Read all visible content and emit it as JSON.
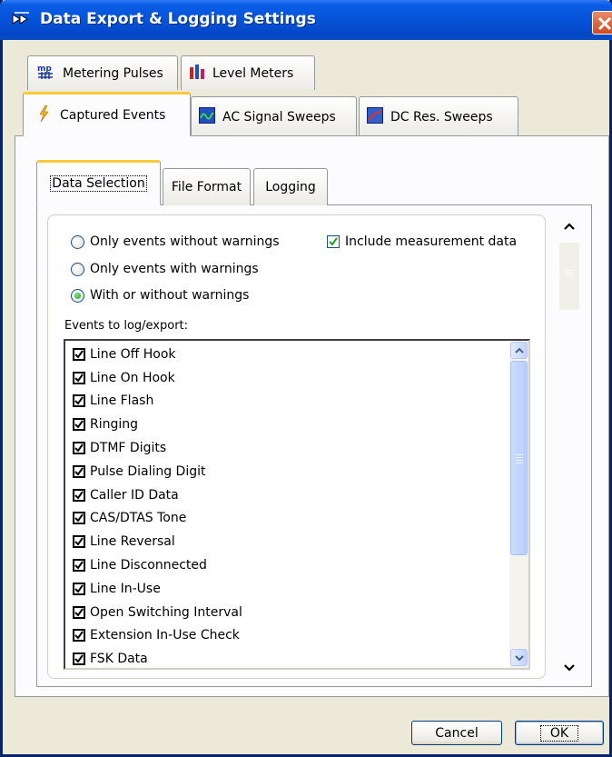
{
  "window": {
    "title": "Data Export & Logging Settings",
    "close_icon": "close-icon"
  },
  "outer_tabs": {
    "row1": [
      {
        "label": "Metering Pulses",
        "icon": "metering-pulses-icon"
      },
      {
        "label": "Level Meters",
        "icon": "level-meters-icon"
      }
    ],
    "row2": [
      {
        "label": "Captured Events",
        "icon": "lightning-icon",
        "active": true
      },
      {
        "label": "AC Signal Sweeps",
        "icon": "ac-sweep-icon"
      },
      {
        "label": "DC Res. Sweeps",
        "icon": "dc-sweep-icon"
      }
    ]
  },
  "inner_tabs": [
    {
      "label": "Data Selection",
      "active": true
    },
    {
      "label": "File Format"
    },
    {
      "label": "Logging"
    }
  ],
  "warnings_filter": {
    "options": [
      {
        "label": "Only events without warnings",
        "checked": false
      },
      {
        "label": "Only events with warnings",
        "checked": false
      },
      {
        "label": "With or without warnings",
        "checked": true
      }
    ]
  },
  "include_measurement": {
    "label": "Include measurement data",
    "checked": true
  },
  "events": {
    "label": "Events to log/export:",
    "items": [
      {
        "label": "Line Off Hook",
        "checked": true
      },
      {
        "label": "Line On Hook",
        "checked": true
      },
      {
        "label": "Line Flash",
        "checked": true
      },
      {
        "label": "Ringing",
        "checked": true
      },
      {
        "label": "DTMF Digits",
        "checked": true
      },
      {
        "label": "Pulse Dialing Digit",
        "checked": true
      },
      {
        "label": "Caller ID Data",
        "checked": true
      },
      {
        "label": "CAS/DTAS Tone",
        "checked": true
      },
      {
        "label": "Line Reversal",
        "checked": true
      },
      {
        "label": "Line Disconnected",
        "checked": true
      },
      {
        "label": "Line In-Use",
        "checked": true
      },
      {
        "label": "Open Switching Interval",
        "checked": true
      },
      {
        "label": "Extension In-Use Check",
        "checked": true
      },
      {
        "label": "FSK Data",
        "checked": true
      }
    ]
  },
  "buttons": {
    "cancel": "Cancel",
    "ok": "OK"
  },
  "colors": {
    "titlebar": "#0553d8",
    "active_tab_accent": "#ffc83c",
    "dialog_bg": "#ece9d8",
    "check_green": "#21a121"
  }
}
